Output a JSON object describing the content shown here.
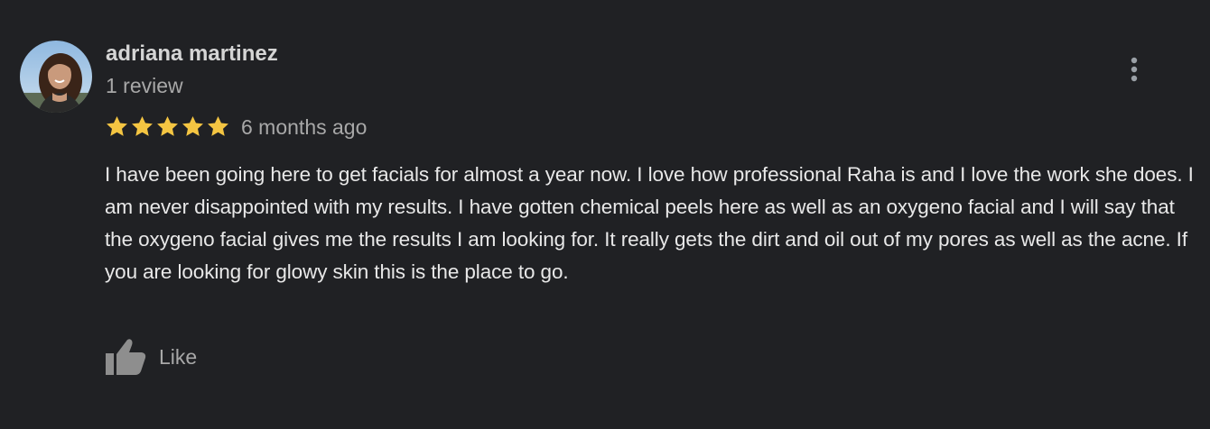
{
  "review": {
    "author_name": "adriana martinez",
    "review_count": "1 review",
    "rating": 5,
    "rating_max": 5,
    "date": "6 months ago",
    "text": "I have been going here to get facials for almost a year now. I love how professional Raha is and I love the work she does. I am never disappointed with my results. I have gotten chemical peels here as well as an oxygeno facial and I will say that the oxygeno facial gives me the results I am looking for. It really gets the dirt and oil out of my pores as well as the acne. If you are looking for glowy skin this is the place to go.",
    "like_label": "Like"
  },
  "icons": {
    "star": "star-icon",
    "more": "more-vert-icon",
    "like": "thumb-up-icon"
  },
  "colors": {
    "background": "#202124",
    "star": "#f4c542",
    "author": "#d5d5d5",
    "secondary_text": "#a8a8a8",
    "body_text": "#e8e8e8"
  }
}
